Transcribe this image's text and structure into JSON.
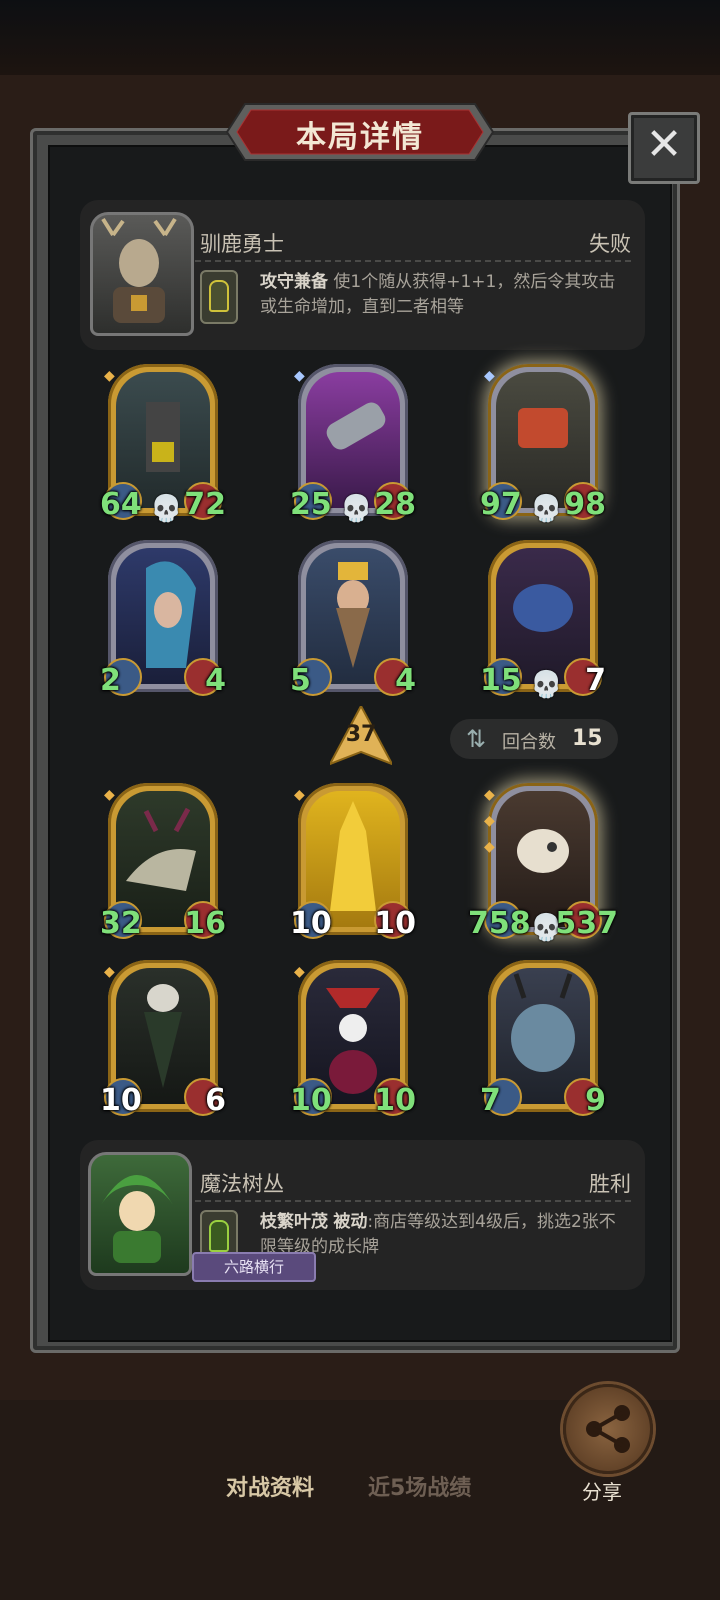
{
  "header": {
    "title": "本局详情",
    "close_icon": "close-icon"
  },
  "opponent": {
    "name": "驯鹿勇士",
    "result": "失败",
    "ability_name": "攻守兼备",
    "ability_desc": "使1个随从获得+1+1，然后令其攻击或生命增加，直到二者相等"
  },
  "opponent_cards": [
    {
      "attack": "64",
      "health": "72",
      "dead": true,
      "frame": "gold"
    },
    {
      "attack": "25",
      "health": "28",
      "dead": true,
      "frame": "silver"
    },
    {
      "attack": "97",
      "health": "98",
      "dead": true,
      "frame": "silver-glow"
    },
    {
      "attack": "2",
      "health": "4",
      "dead": false,
      "frame": "silver"
    },
    {
      "attack": "5",
      "health": "4",
      "dead": false,
      "frame": "silver"
    },
    {
      "attack": "15",
      "health": "7",
      "dead": true,
      "frame": "gold"
    }
  ],
  "tier_value": "37",
  "rounds": {
    "label": "回合数",
    "value": "15"
  },
  "player_cards": [
    {
      "attack": "32",
      "health": "16",
      "dead": false,
      "frame": "gold"
    },
    {
      "attack": "10",
      "health": "10",
      "dead": false,
      "frame": "gold"
    },
    {
      "attack": "758",
      "health": "537",
      "dead": true,
      "frame": "silver-glow"
    },
    {
      "attack": "10",
      "health": "6",
      "dead": false,
      "frame": "gold"
    },
    {
      "attack": "10",
      "health": "10",
      "dead": false,
      "frame": "gold"
    },
    {
      "attack": "7",
      "health": "9",
      "dead": false,
      "frame": "gold"
    }
  ],
  "player": {
    "name": "魔法树丛",
    "result": "胜利",
    "ability_name": "枝繁叶茂",
    "ability_tag": "被动",
    "ability_desc": ":商店等级达到4级后，挑选2张不限等级的成长牌",
    "badge": "六路横行"
  },
  "bottom": {
    "tab_active": "对战资料",
    "tab_inactive": "近5场战绩",
    "share_label": "分享"
  },
  "colors": {
    "stat_green": "#7fe07a",
    "gold_frame": "#c99a33",
    "panel_bg": "#181a1b",
    "title_red": "#7a1a1a"
  }
}
